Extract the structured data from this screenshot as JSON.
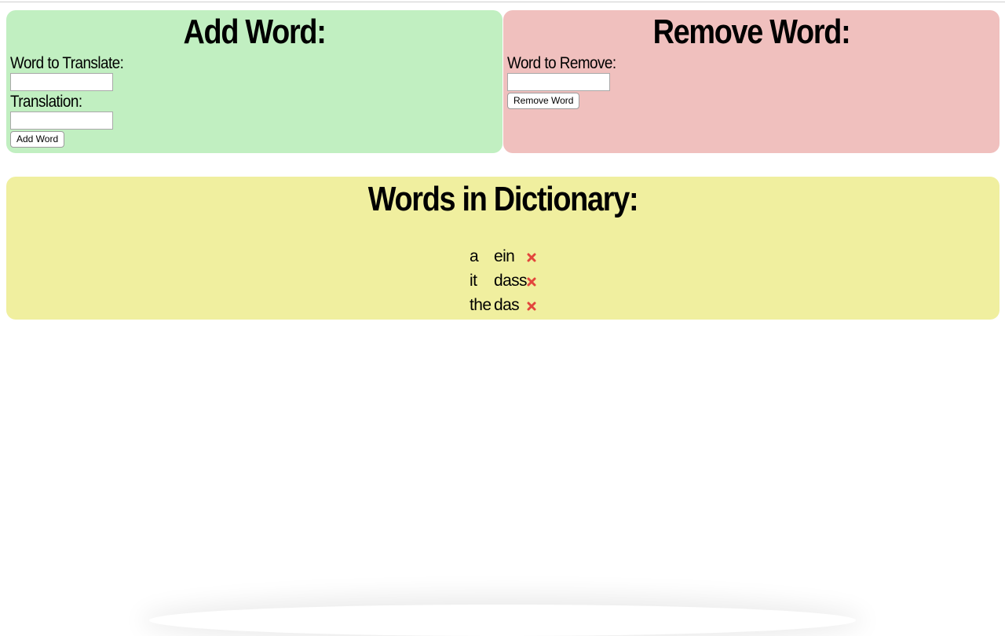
{
  "add_panel": {
    "title": "Add Word:",
    "word_label": "Word to Translate:",
    "word_value": "",
    "translation_label": "Translation:",
    "translation_value": "",
    "button_label": "Add Word",
    "bg_color": "#c1efc1"
  },
  "remove_panel": {
    "title": "Remove Word:",
    "word_label": "Word to Remove:",
    "word_value": "",
    "button_label": "Remove Word",
    "bg_color": "#f0c0be"
  },
  "dictionary": {
    "title": "Words in Dictionary:",
    "bg_color": "#f0ef9f",
    "entries": [
      {
        "word": "a",
        "translation": "ein",
        "delete_icon": "close-icon"
      },
      {
        "word": "it",
        "translation": "dass",
        "delete_icon": "close-icon"
      },
      {
        "word": "the",
        "translation": "das",
        "delete_icon": "close-icon"
      }
    ]
  }
}
